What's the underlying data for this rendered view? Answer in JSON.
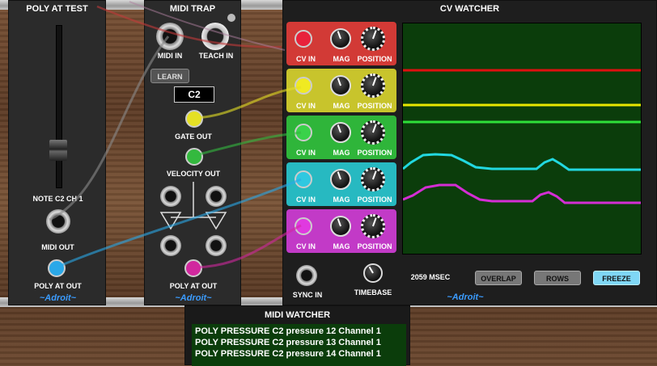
{
  "poly_at_test": {
    "title": "POLY AT TEST",
    "note_label": "NOTE C2 CH 1",
    "midi_out_label": "MIDI  OUT",
    "poly_at_out_label": "POLY AT OUT",
    "logo": "~Adroit~"
  },
  "midi_trap": {
    "title": "MIDI TRAP",
    "midi_in_label": "MIDI IN",
    "teach_in_label": "TEACH IN",
    "learn_label": "LEARN",
    "note_display": "C2",
    "gate_out_label": "GATE OUT",
    "velocity_out_label": "VELOCITY OUT",
    "poly_at_out_label": "POLY AT OUT",
    "logo": "~Adroit~"
  },
  "cv_watcher": {
    "title": "CV WATCHER",
    "channels": [
      {
        "color": "#d23a36",
        "led": "#e8213b",
        "cv_in": "CV IN",
        "mag": "MAG",
        "position": "POSITION"
      },
      {
        "color": "#c8c42c",
        "led": "#f0ea22",
        "cv_in": "CV IN",
        "mag": "MAG",
        "position": "POSITION"
      },
      {
        "color": "#2fb53a",
        "led": "#3ad24a",
        "cv_in": "CV IN",
        "mag": "MAG",
        "position": "POSITION"
      },
      {
        "color": "#27b9c1",
        "led": "#30c8e0",
        "cv_in": "CV IN",
        "mag": "MAG",
        "position": "POSITION"
      },
      {
        "color": "#c23ac7",
        "led": "#e03ae0",
        "cv_in": "CV IN",
        "mag": "MAG",
        "position": "POSITION"
      }
    ],
    "sync_in_label": "SYNC IN",
    "timebase_label": "TIMEBASE",
    "msec_readout": "2059 MSEC",
    "overlap_label": "OVERLAP",
    "rows_label": "ROWS",
    "freeze_label": "FREEZE",
    "logo": "~Adroit~"
  },
  "midi_watcher": {
    "title": "MIDI WATCHER",
    "lines": [
      "POLY PRESSURE C2  pressure 12  Channel 1",
      "POLY PRESSURE C2  pressure 13  Channel 1",
      "POLY PRESSURE C2  pressure 14  Channel 1"
    ]
  }
}
